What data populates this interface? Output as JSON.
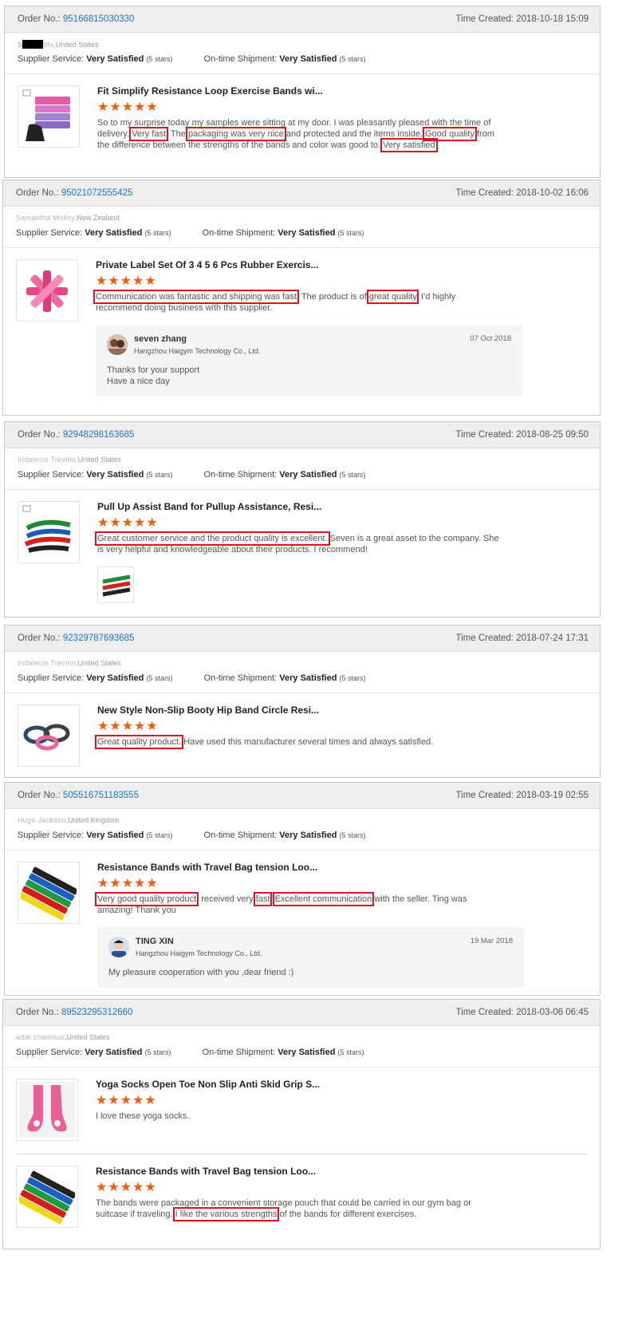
{
  "labels": {
    "order_no": "Order No.:",
    "time_created": "Time Created:",
    "supplier_service": "Supplier Service:",
    "ontime_shipment": "On-time Shipment:",
    "rating_value": "Very Satisfied",
    "rating_stars": "(5 stars)",
    "stars": "★★★★★"
  },
  "colors": {
    "accent_link": "#1d77c8",
    "star": "#f35b12",
    "highlight_box": "#e0141e"
  },
  "reviews": [
    {
      "order_no": "95166815030330",
      "time_created": "2018-10-18 15:09",
      "buyer_prefix": "S",
      "buyer_blur": "Mu",
      "buyer_country": ",United States",
      "items": [
        {
          "title": "Fit Simplify Resistance Loop Exercise Bands wi...",
          "thumb_icon": "resistance-loop-bands-pink-purple",
          "text_parts": [
            "So to my surprise today my samples were sitting at my door. I was pleasantly pleased with the time of delivery. ",
            "Very fast",
            ". The ",
            "packaging was very nice",
            " and protected and the items inside. ",
            "Good quality",
            " from the difference between the strengths of the bands and color was good to. ",
            "Very satisfied"
          ]
        }
      ]
    },
    {
      "order_no": "95021072555425",
      "time_created": "2018-10-02 16:06",
      "buyer_blur": "Samantha Molloy",
      "buyer_country": ",New Zealand",
      "items": [
        {
          "title": "Private Label Set Of 3 4 5 6 Pcs Rubber Exercis...",
          "thumb_icon": "rubber-bands-pink-fan",
          "text_parts": [
            "Communication was fantastic and shipping was fast",
            ". The product is of ",
            "great quality",
            ", I'd highly recommend doing business with this supplier."
          ]
        }
      ],
      "reply": {
        "name": "seven zhang",
        "company": "Hangzhou Haigym Technology Co., Ltd.",
        "date": "07 Oct 2018",
        "lines": [
          "Thanks for your support",
          "Have a nice day"
        ]
      }
    },
    {
      "order_no": "92948298163685",
      "time_created": "2018-08-25 09:50",
      "buyer_blur": "Indalecio Trevino",
      "buyer_country": ",United States",
      "items": [
        {
          "title": "Pull Up Assist Band for Pullup Assistance, Resi...",
          "thumb_icon": "pull-up-bands-multicolor",
          "text_parts": [
            "Great customer service and the product quality is excellent.",
            " Seven is a great asset to the company.  She is very helpful and knowledgeable about their products.  I recommend!"
          ]
        }
      ]
    },
    {
      "order_no": "92329787693685",
      "time_created": "2018-07-24 17:31",
      "buyer_blur": "Indalecio Trevino",
      "buyer_country": ",United States",
      "items": [
        {
          "title": "New Style Non-Slip Booty Hip Band Circle Resi...",
          "thumb_icon": "hip-band-circles",
          "text_parts": [
            "Great quality product.",
            " Have used this manufacturer several times and always satisfied."
          ]
        }
      ]
    },
    {
      "order_no": "505516751183555",
      "time_created": "2018-03-19 02:55",
      "buyer_blur": "Hugo Jackson",
      "buyer_country": ",United Kingdom",
      "items": [
        {
          "title": "Resistance Bands with Travel Bag tension Loo...",
          "thumb_icon": "resistance-bands-rainbow",
          "text_parts": [
            "Very good quality product",
            ", received very ",
            "fast",
            ". ",
            "Excellent communication",
            " with the seller. Ting was amazing! Thank you"
          ]
        }
      ],
      "reply": {
        "name": "TING XIN",
        "company": "Hangzhou Haigym Technology Co., Ltd.",
        "date": "19 Mar 2018",
        "lines": [
          "My pleasure cooperation with you ,dear friend  :)"
        ]
      }
    },
    {
      "order_no": "89523295312660",
      "time_created": "2018-03-06 06:45",
      "buyer_blur": "adar charimus",
      "buyer_country": ",United States",
      "items": [
        {
          "title": "Yoga Socks Open Toe Non Slip Anti Skid Grip S...",
          "thumb_icon": "yoga-socks-pink",
          "text_parts": [
            "I love these yoga socks."
          ]
        },
        {
          "title": "Resistance Bands with Travel Bag tension Loo...",
          "thumb_icon": "resistance-bands-rainbow",
          "text_parts": [
            "The bands were packaged in a convenient storage pouch that could be carried in our gym bag or suitcase if traveling. ",
            "I like the various strengths",
            " of the bands for different exercises."
          ]
        }
      ]
    }
  ]
}
